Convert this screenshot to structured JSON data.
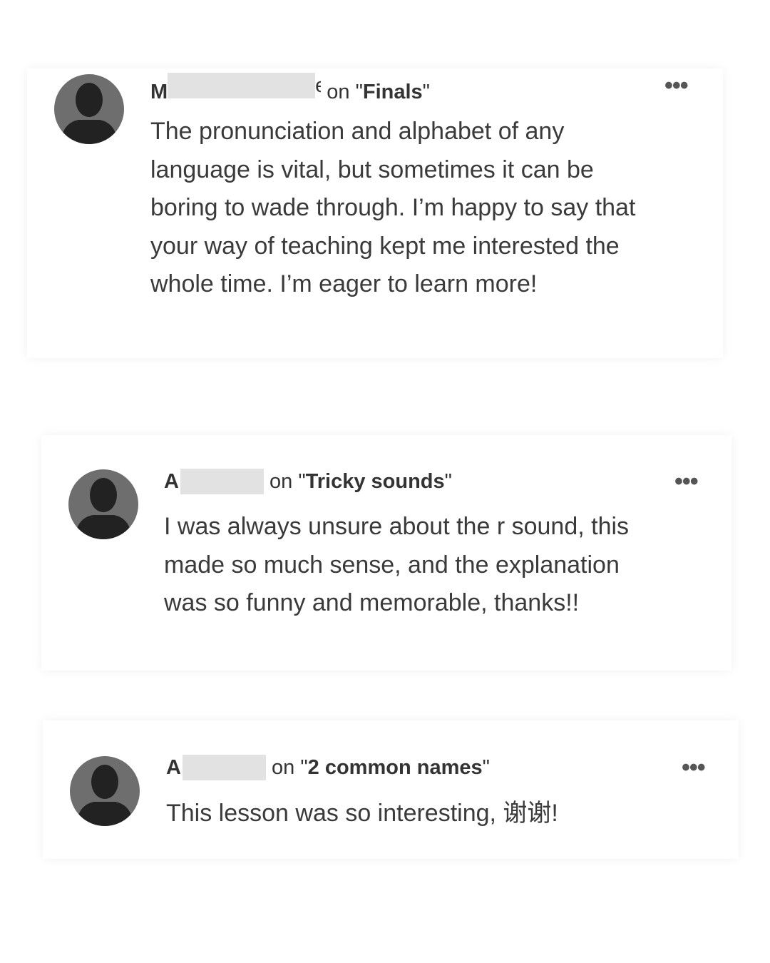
{
  "comments": [
    {
      "author_initial": "M",
      "author_tail": "e",
      "on_text": "on",
      "quote_open": "\"",
      "lesson": "Finals",
      "quote_close": "\"",
      "text": "The pronunciation and alphabet of any language is vital, but sometimes it can be boring to wade through. I’m happy to say that your way of teaching kept me interested the whole time. I’m eager to learn more!",
      "more_icon": "more-horizontal-icon",
      "more_label": "•••"
    },
    {
      "author_initial": "A",
      "on_text": "on",
      "quote_open": "\"",
      "lesson": "Tricky sounds",
      "quote_close": "\"",
      "text": "I was always unsure about the r sound, this made so much sense, and the explanation was so funny and memorable, thanks!!",
      "more_icon": "more-horizontal-icon",
      "more_label": "•••"
    },
    {
      "author_initial": "A",
      "on_text": "on",
      "quote_open": "\"",
      "lesson": "2 common names",
      "quote_close": "\"",
      "text": "This lesson was so interesting, 谢谢!",
      "more_icon": "more-horizontal-icon",
      "more_label": "•••"
    }
  ],
  "colors": {
    "avatar_bg": "#6e6e6e",
    "avatar_silhouette": "#222222",
    "redaction": "#e2e2e2",
    "text": "#3a3a3a"
  }
}
